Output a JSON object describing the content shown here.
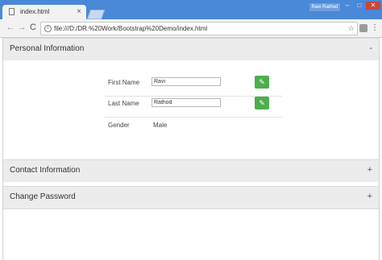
{
  "browser": {
    "tab_title": "index.html",
    "tab_close": "×",
    "user_label": "Ravi Rathod",
    "window_minimize": "–",
    "window_maximize": "□",
    "window_close": "✕",
    "nav_back": "←",
    "nav_forward": "→",
    "nav_reload": "C",
    "address": "file:///D:/DR.%20Work/Bootstrap%20Demo/index.html",
    "info_glyph": "i",
    "star_glyph": "☆",
    "menu_glyph": "⋮"
  },
  "panels": {
    "personal": {
      "title": "Personal Information",
      "toggle": "-",
      "first_name_label": "First Name",
      "first_name_value": "Ravi",
      "last_name_label": "Last Name",
      "last_name_value": "Rathod",
      "gender_label": "Gender",
      "gender_value": "Male",
      "edit_glyph": "✎"
    },
    "contact": {
      "title": "Contact Information",
      "toggle": "+"
    },
    "password": {
      "title": "Change Password",
      "toggle": "+"
    }
  },
  "colors": {
    "title_bar": "#4a88d8",
    "edit_button": "#4cae4c",
    "panel_header": "#ececec"
  }
}
